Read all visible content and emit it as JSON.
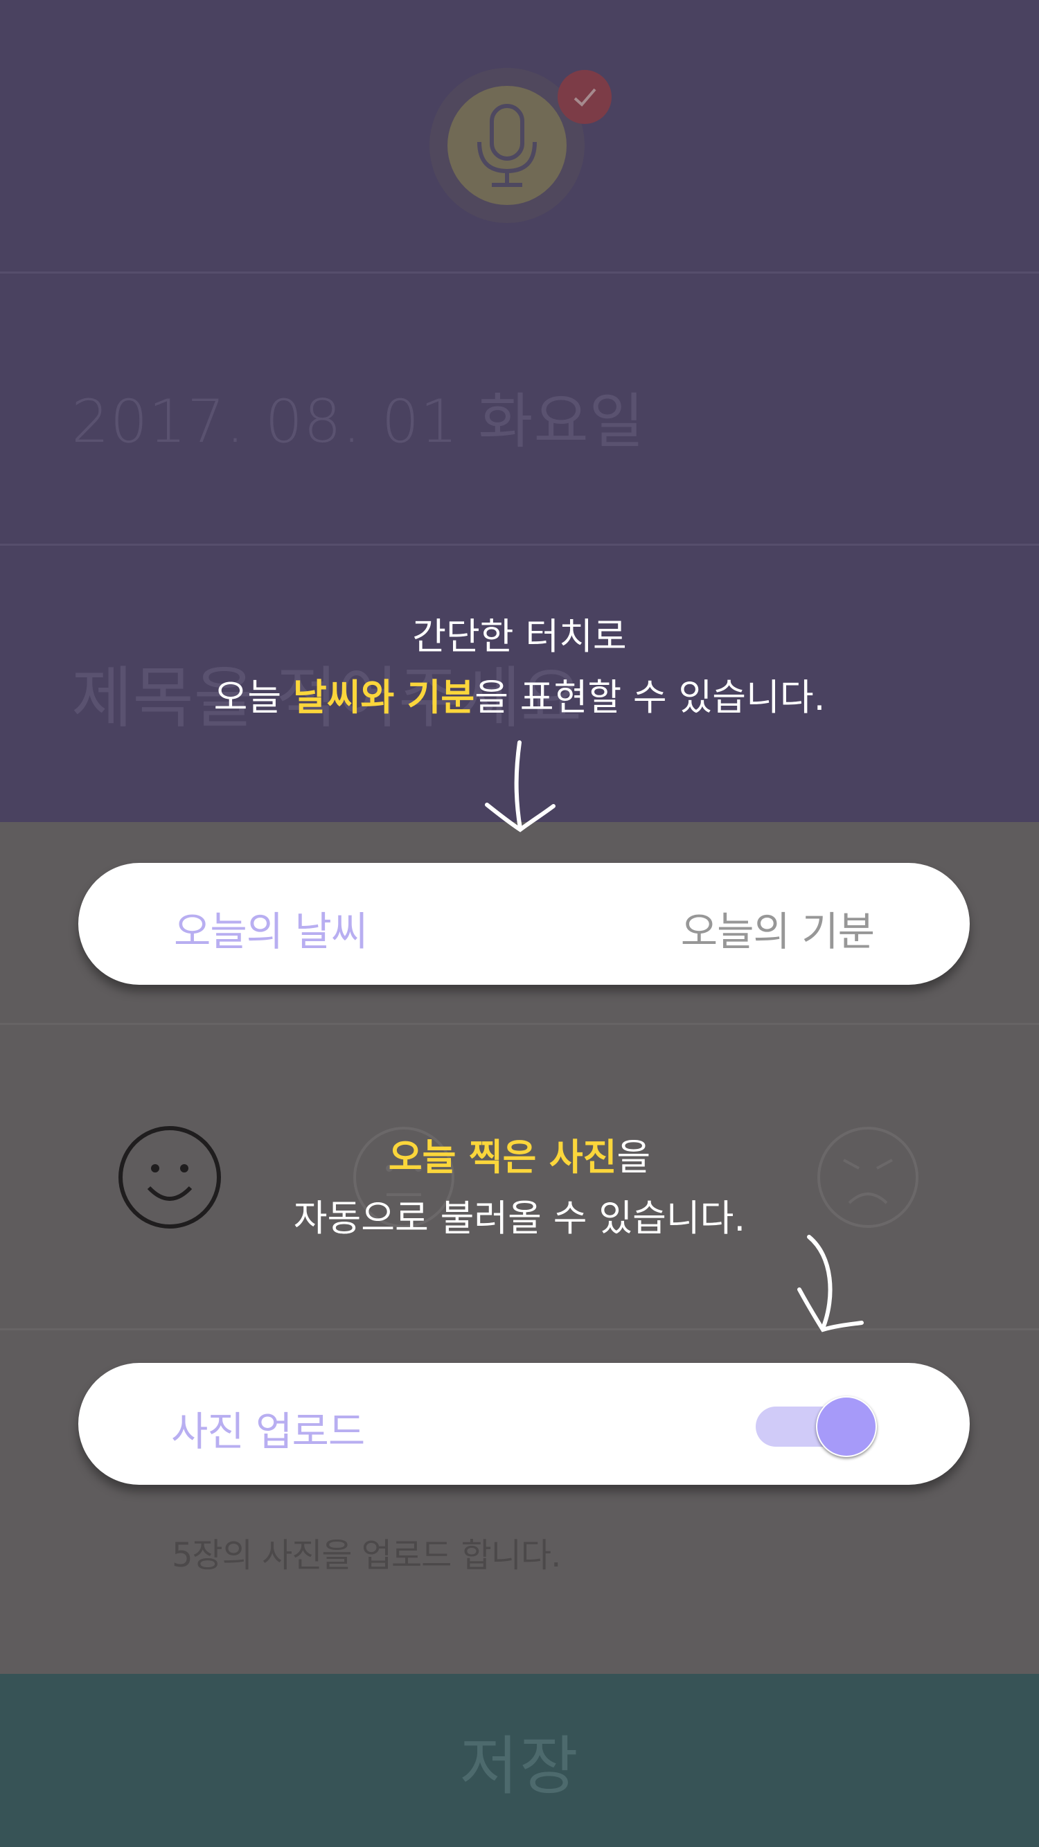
{
  "header": {
    "mic_icon": "microphone-icon",
    "check_icon": "check-icon",
    "check_color": "#c74a4f"
  },
  "diary": {
    "date": "2017. 08. 01 화요일",
    "title_placeholder": "제목을 적어주세요"
  },
  "coach_marks": {
    "first": {
      "line1": "간단한 터치로",
      "line2_prefix": "오늘 ",
      "line2_highlight": "날씨와 기분",
      "line2_suffix": "을 표현할 수 있습니다."
    },
    "second": {
      "line1_highlight": "오늘 찍은 사진",
      "line1_suffix": "을",
      "line2": "자동으로 불러올 수 있습니다."
    },
    "highlight_color": "#fbd63b"
  },
  "weather_mood": {
    "weather_label": "오늘의 날씨",
    "mood_label": "오늘의 기분",
    "faces": [
      "smile-face-icon",
      "neutral-face-icon",
      "angry-face-icon"
    ]
  },
  "photo_upload": {
    "label": "사진 업로드",
    "enabled": true,
    "note": "5장의 사진을 업로드 합니다."
  },
  "footer": {
    "save_label": "저장"
  },
  "colors": {
    "purple_bg": "#4a4260",
    "gray_bg": "#5f5c5d",
    "save_bg": "#375356",
    "accent": "#a69af9"
  }
}
